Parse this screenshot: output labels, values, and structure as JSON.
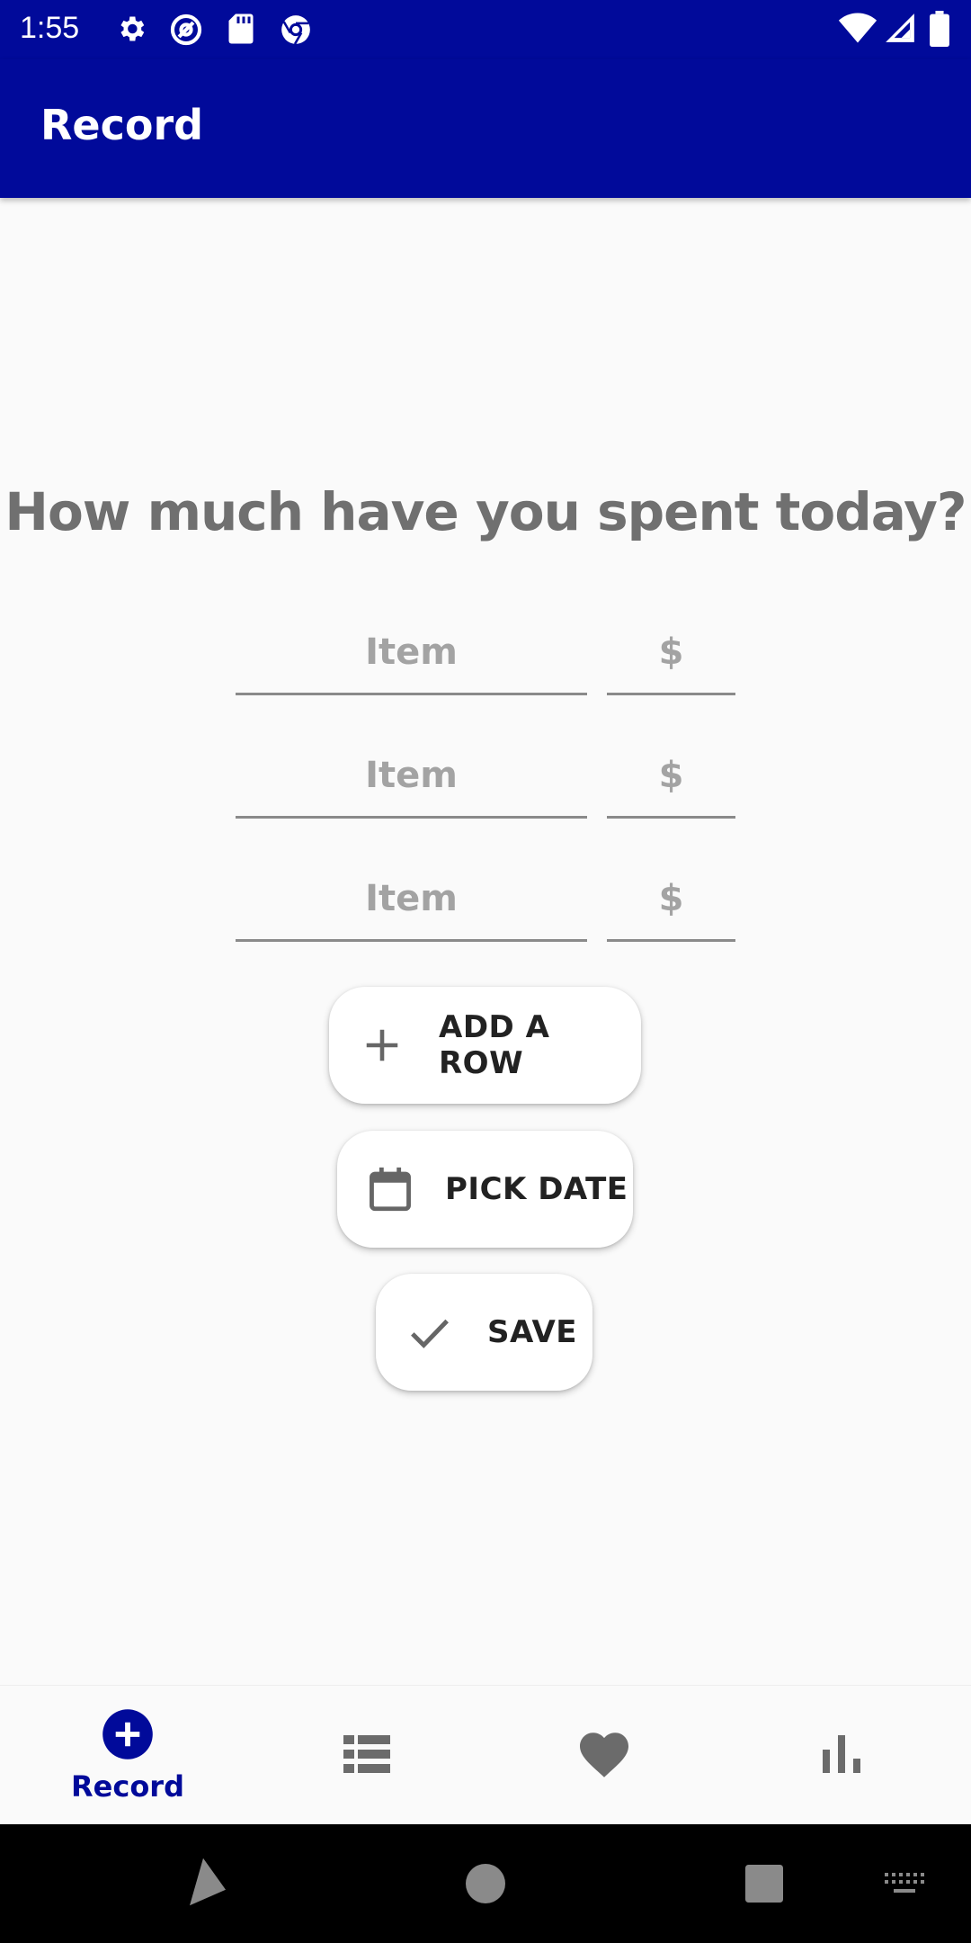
{
  "status_bar": {
    "time": "1:55",
    "left_icons": [
      "settings-icon",
      "at-sign-icon",
      "sd-card-icon",
      "chrome-icon"
    ],
    "right_icons": [
      "wifi-icon",
      "signal-icon",
      "battery-icon"
    ]
  },
  "app_bar": {
    "title": "Record",
    "background": "#010a9a"
  },
  "main": {
    "heading": "How much have you spent today?",
    "rows": [
      {
        "item_placeholder": "Item",
        "amount_placeholder": "$"
      },
      {
        "item_placeholder": "Item",
        "amount_placeholder": "$"
      },
      {
        "item_placeholder": "Item",
        "amount_placeholder": "$"
      }
    ],
    "buttons": {
      "add_row": {
        "label": "ADD A ROW",
        "icon": "plus-icon"
      },
      "pick_date": {
        "label": "PICK DATE",
        "icon": "calendar-icon"
      },
      "save": {
        "label": "SAVE",
        "icon": "check-icon"
      }
    }
  },
  "bottom_nav": {
    "items": [
      {
        "label": "Record",
        "icon": "add-circle-icon",
        "active": true
      },
      {
        "label": "",
        "icon": "list-icon",
        "active": false
      },
      {
        "label": "",
        "icon": "heart-icon",
        "active": false
      },
      {
        "label": "",
        "icon": "bar-chart-icon",
        "active": false
      }
    ],
    "active_color": "#010a9a",
    "inactive_color": "#6b6b6b"
  },
  "system_nav": [
    "back-icon",
    "home-icon",
    "recents-icon",
    "keyboard-icon"
  ]
}
